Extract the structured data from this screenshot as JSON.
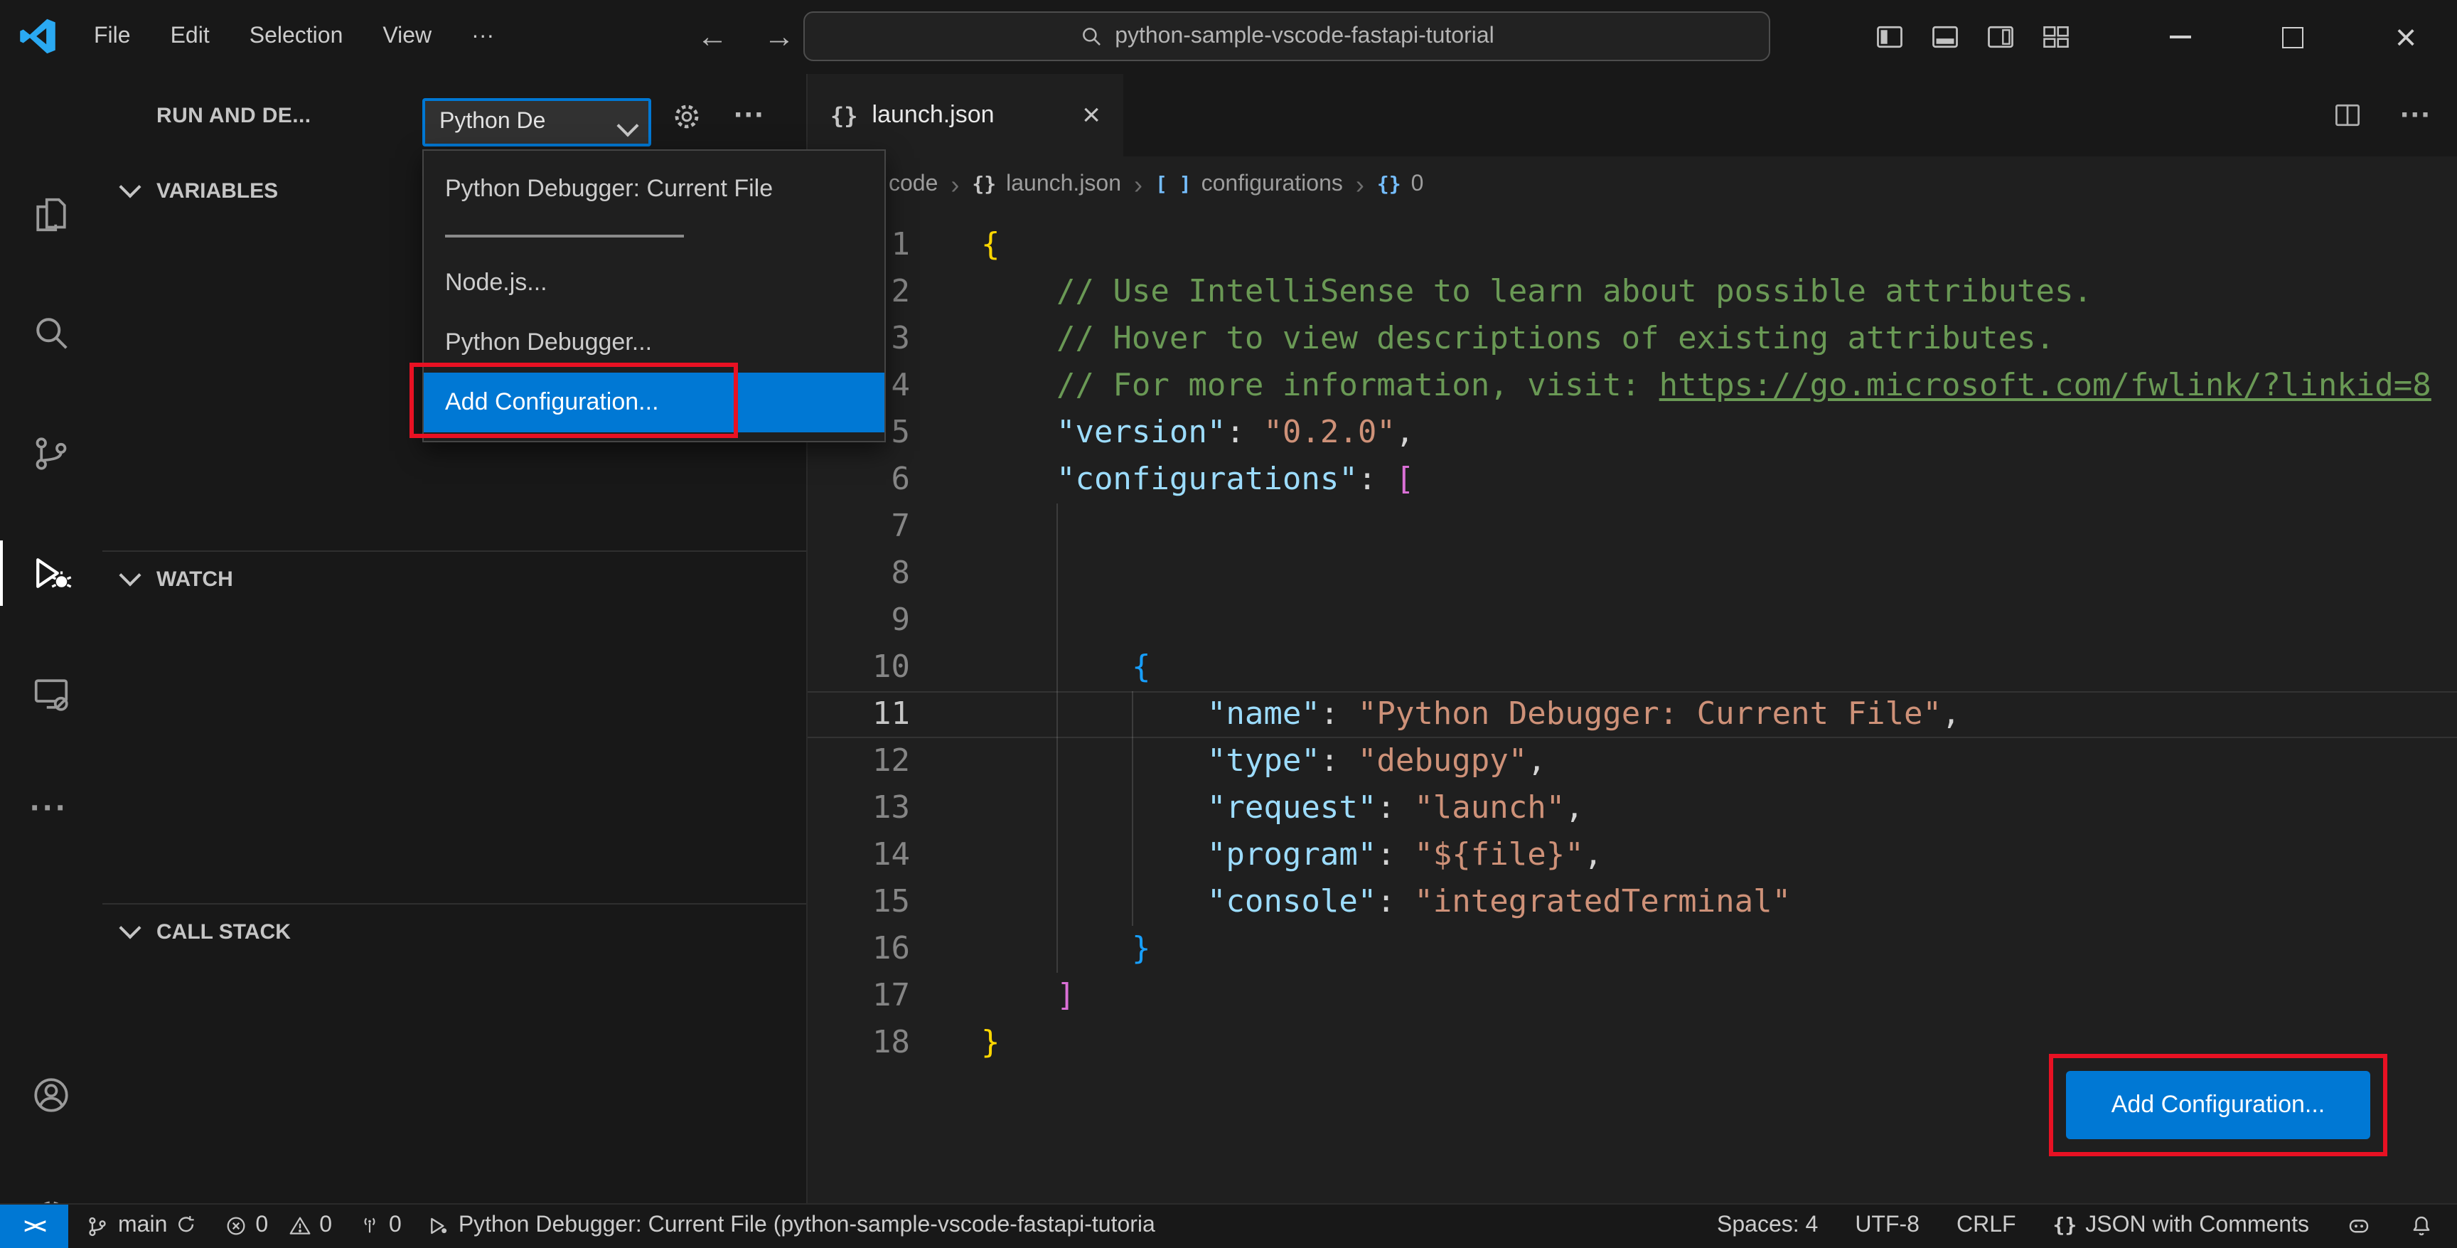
{
  "colors": {
    "accent": "#0078d4",
    "annotation_red": "#e81123",
    "run_green": "#89d185",
    "editor_bg": "#1f1f1f",
    "chrome_bg": "#181818"
  },
  "icons": {
    "back": "←",
    "forward": "→",
    "more": "···",
    "close": "×",
    "braces": "{}",
    "brackets": "[ ]",
    "crumb_sep": "›",
    "remote": "><"
  },
  "title_bar": {
    "menus": [
      {
        "label": "File"
      },
      {
        "label": "Edit"
      },
      {
        "label": "Selection"
      },
      {
        "label": "View"
      }
    ],
    "search_value": "python-sample-vscode-fastapi-tutorial"
  },
  "activity_bar": {
    "items": [
      "explorer",
      "search",
      "source-control",
      "run-and-debug",
      "remote-explorer",
      "more"
    ],
    "active": "run-and-debug",
    "bottom": [
      "account",
      "settings"
    ]
  },
  "sidebar": {
    "title": "RUN AND DE...",
    "config_picker_value": "Python De",
    "dropdown_items": [
      {
        "label": "Python Debugger: Current File"
      },
      {
        "label": "Node.js..."
      },
      {
        "label": "Python Debugger..."
      },
      {
        "label": "Add Configuration...",
        "selected": true
      }
    ],
    "sections": [
      {
        "label": "VARIABLES"
      },
      {
        "label": "WATCH"
      },
      {
        "label": "CALL STACK"
      }
    ]
  },
  "editor": {
    "tab": {
      "icon": "{}",
      "label": "launch.json"
    },
    "breadcrumbs": [
      {
        "label": "code"
      },
      {
        "icon": "{}",
        "label": "launch.json"
      },
      {
        "icon": "[ ]",
        "label": "configurations"
      },
      {
        "icon": "{}",
        "label": "0"
      }
    ],
    "add_config_button_label": "Add Configuration...",
    "lines": [
      {
        "n": 1,
        "tokens": [
          [
            "b1",
            "{"
          ]
        ]
      },
      {
        "n": 2,
        "tokens": [
          [
            "cm",
            "    // Use IntelliSense to learn about possible attributes."
          ]
        ]
      },
      {
        "n": 3,
        "tokens": [
          [
            "cm",
            "    // Hover to view descriptions of existing attributes."
          ]
        ]
      },
      {
        "n": 4,
        "tokens": [
          [
            "cm",
            "    // For more information, visit: "
          ],
          [
            "lk",
            "https://go.microsoft.com/fwlink/?linkid=8"
          ]
        ]
      },
      {
        "n": 5,
        "tokens": [
          [
            "pr",
            "    \"version\""
          ],
          [
            "pl",
            ": "
          ],
          [
            "st",
            "\"0.2.0\""
          ],
          [
            "pl",
            ","
          ]
        ]
      },
      {
        "n": 6,
        "tokens": [
          [
            "pr",
            "    \"configurations\""
          ],
          [
            "pl",
            ": "
          ],
          [
            "b2",
            "["
          ]
        ]
      },
      {
        "n": 7,
        "tokens": []
      },
      {
        "n": 8,
        "tokens": []
      },
      {
        "n": 9,
        "tokens": []
      },
      {
        "n": 10,
        "tokens": [
          [
            "pl",
            "        "
          ],
          [
            "b3",
            "{"
          ]
        ]
      },
      {
        "n": 11,
        "current": true,
        "tokens": [
          [
            "pr",
            "            \"name\""
          ],
          [
            "pl",
            ": "
          ],
          [
            "st",
            "\"Python Debugger: Current File\""
          ],
          [
            "pl",
            ","
          ]
        ]
      },
      {
        "n": 12,
        "tokens": [
          [
            "pr",
            "            \"type\""
          ],
          [
            "pl",
            ": "
          ],
          [
            "st",
            "\"debugpy\""
          ],
          [
            "pl",
            ","
          ]
        ]
      },
      {
        "n": 13,
        "tokens": [
          [
            "pr",
            "            \"request\""
          ],
          [
            "pl",
            ": "
          ],
          [
            "st",
            "\"launch\""
          ],
          [
            "pl",
            ","
          ]
        ]
      },
      {
        "n": 14,
        "tokens": [
          [
            "pr",
            "            \"program\""
          ],
          [
            "pl",
            ": "
          ],
          [
            "st",
            "\"${file}\""
          ],
          [
            "pl",
            ","
          ]
        ]
      },
      {
        "n": 15,
        "tokens": [
          [
            "pr",
            "            \"console\""
          ],
          [
            "pl",
            ": "
          ],
          [
            "st",
            "\"integratedTerminal\""
          ]
        ]
      },
      {
        "n": 16,
        "tokens": [
          [
            "pl",
            "        "
          ],
          [
            "b3",
            "}"
          ]
        ]
      },
      {
        "n": 17,
        "tokens": [
          [
            "pl",
            "    "
          ],
          [
            "b2",
            "]"
          ]
        ]
      },
      {
        "n": 18,
        "tokens": [
          [
            "b1",
            "}"
          ]
        ]
      }
    ]
  },
  "status_bar": {
    "remote_label": "><",
    "branch": "main",
    "errors": "0",
    "warnings": "0",
    "ports": "0",
    "debug_status": "Python Debugger: Current File (python-sample-vscode-fastapi-tutoria",
    "spaces": "Spaces: 4",
    "encoding": "UTF-8",
    "eol": "CRLF",
    "language_icon": "{}",
    "language": "JSON with Comments"
  }
}
